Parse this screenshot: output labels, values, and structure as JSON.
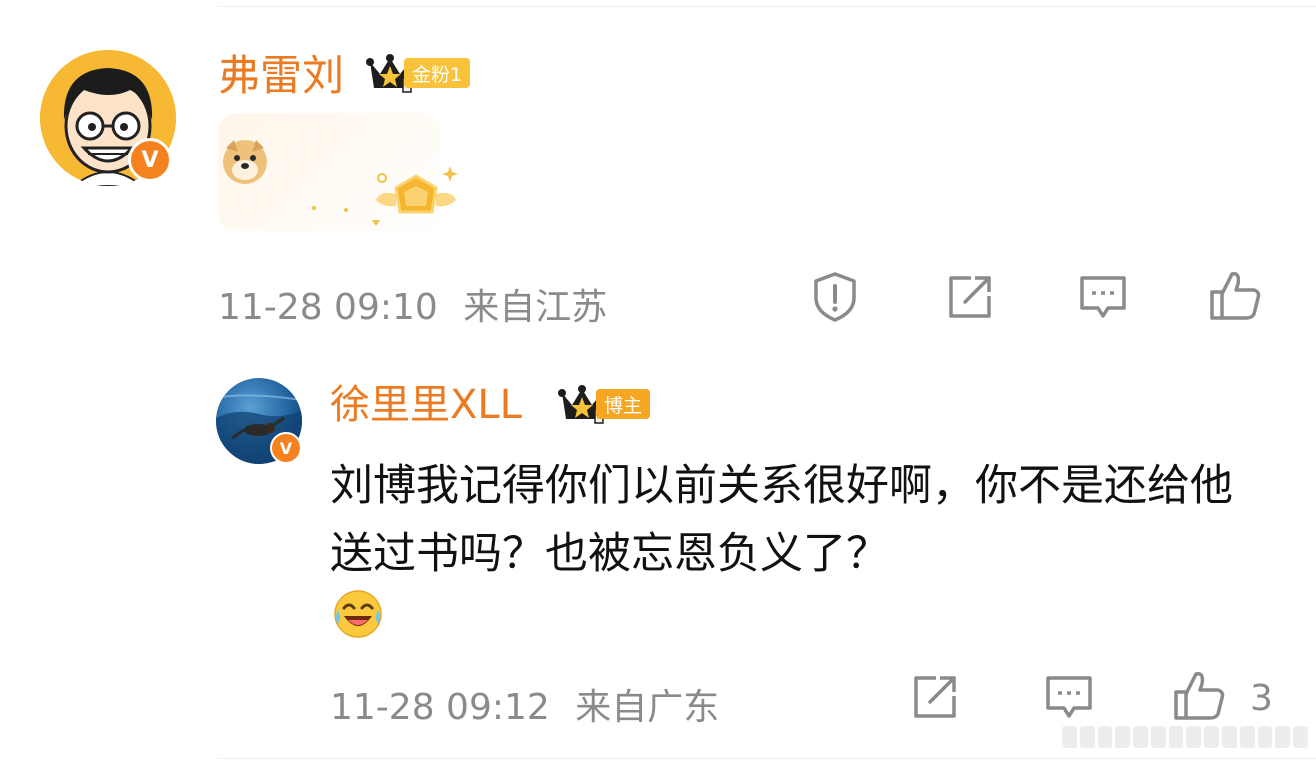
{
  "comment": {
    "username": "弗雷刘",
    "fan_badge": "金粉1",
    "timestamp": "11-28 09:10",
    "location": "来自江苏",
    "verified_mark": "V",
    "icons": [
      "report-icon",
      "share-icon",
      "comment-icon",
      "like-icon"
    ]
  },
  "reply": {
    "username": "徐里里XLL",
    "role_badge": "博主",
    "text": "刘博我记得你们以前关系很好啊，你不是还给他送过书吗？也被忘恩负义了？",
    "timestamp": "11-28 09:12",
    "location": "来自广东",
    "like_count": "3",
    "verified_mark": "V",
    "icons": [
      "share-icon",
      "comment-icon",
      "like-icon"
    ]
  },
  "colors": {
    "username": "#eb7b22",
    "meta": "#8a8a8a",
    "badge_gold": "#f8c23a",
    "verified": "#f5811f"
  }
}
